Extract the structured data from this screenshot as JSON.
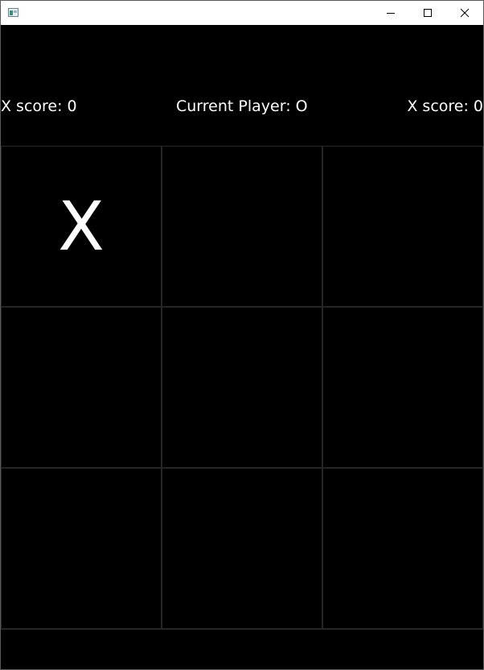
{
  "window": {
    "title": "",
    "icon": "app-icon",
    "controls": [
      "minimize-icon",
      "maximize-icon",
      "close-icon"
    ]
  },
  "scoreboard": {
    "left_score": "X score: 0",
    "current_player": "Current Player: O",
    "right_score": "X score: 0"
  },
  "board": {
    "rows": 3,
    "cols": 3,
    "cells": [
      "X",
      "",
      "",
      "",
      "",
      "",
      "",
      "",
      ""
    ]
  },
  "colors": {
    "background": "#000000",
    "text": "#ffffff",
    "grid_lines": "#262626",
    "titlebar": "#ffffff"
  }
}
